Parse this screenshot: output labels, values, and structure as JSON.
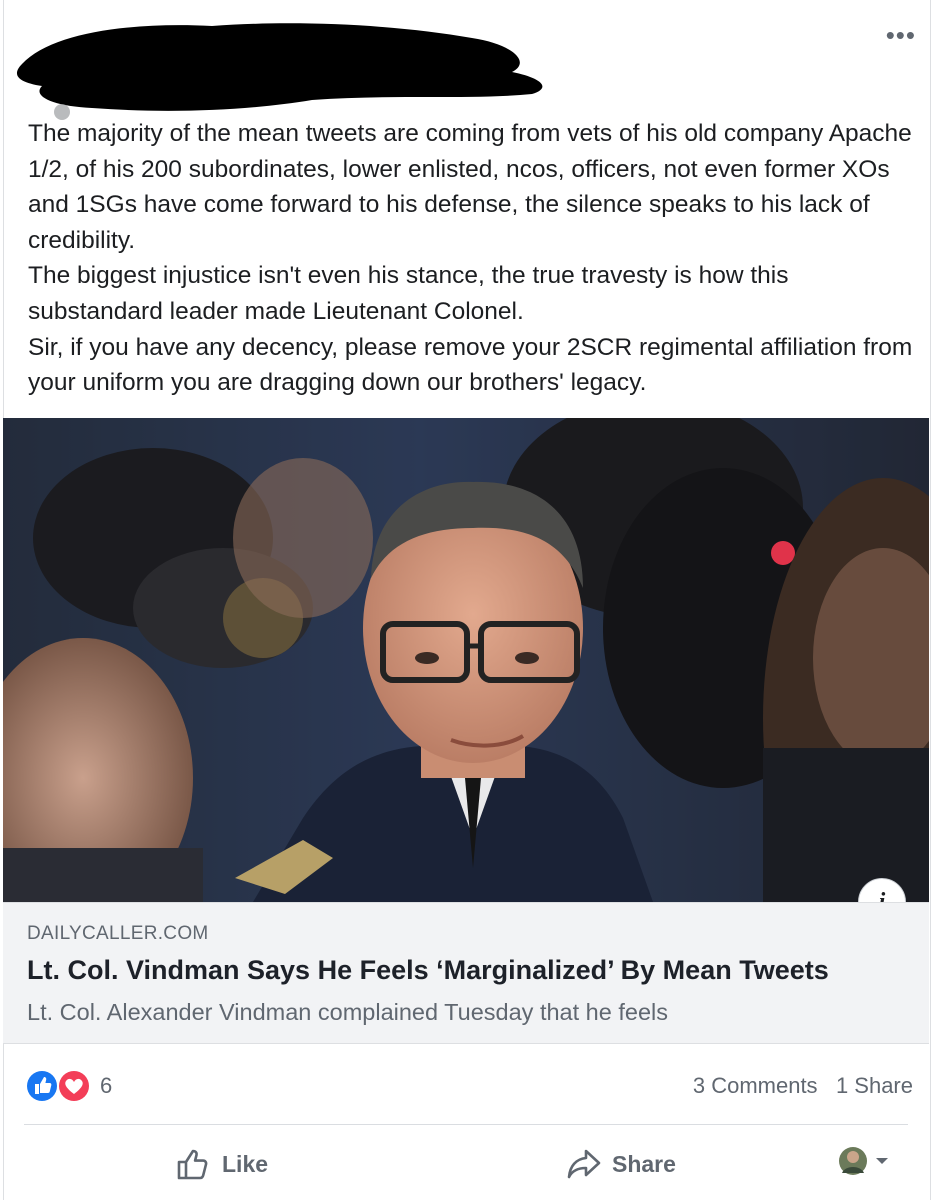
{
  "post": {
    "author_redacted": true,
    "text_lines": [
      "The majority of the mean tweets are coming from vets of his old company Apache 1/2, of his 200 subordinates, lower enlisted, ncos, officers, not even former XOs and 1SGs have come forward to his defense, the silence speaks to his lack of credibility.",
      "The biggest injustice isn't even his stance, the true travesty is how this substandard leader made Lieutenant Colonel.",
      "Sir, if you have any decency, please remove your 2SCR regimental affiliation from your uniform you are dragging down our brothers' legacy."
    ],
    "more_options_icon": "ellipsis-icon"
  },
  "link_preview": {
    "domain": "DAILYCALLER.COM",
    "title": "Lt. Col. Vindman Says He Feels ‘Marginalized’ By Mean Tweets",
    "description": "Lt. Col. Alexander Vindman complained Tuesday that he feels",
    "info_icon": "i"
  },
  "reactions": {
    "types": [
      "like-icon",
      "love-icon"
    ],
    "count": "6",
    "comments": "3 Comments",
    "shares": "1 Share",
    "like_color": "#1877f2",
    "love_color": "#f33e58"
  },
  "actions": {
    "like_label": "Like",
    "share_label": "Share"
  }
}
